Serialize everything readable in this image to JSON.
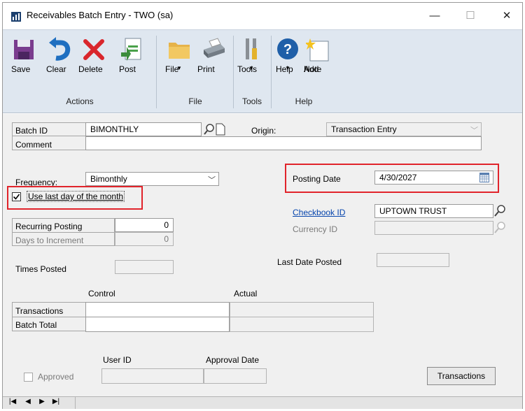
{
  "window": {
    "title": "Receivables Batch Entry  -  TWO (sa)",
    "minimize": "—",
    "maximize": "☐",
    "close": "✕"
  },
  "ribbon": {
    "buttons": {
      "save": "Save",
      "clear": "Clear",
      "delete": "Delete",
      "post": "Post",
      "file": "File",
      "print": "Print",
      "tools": "Tools",
      "help": "Help",
      "add_note_1": "Add",
      "add_note_2": "Note"
    },
    "groups": {
      "actions": "Actions",
      "file": "File",
      "tools": "Tools",
      "help": "Help"
    },
    "accent": "#1f5fa8"
  },
  "form": {
    "batch_id_label": "Batch ID",
    "batch_id_value": "BIMONTHLY",
    "origin_label": "Origin:",
    "origin_value": "Transaction Entry",
    "comment_label": "Comment",
    "comment_value": "",
    "frequency_label": "Frequency:",
    "frequency_value": "Bimonthly",
    "use_last_day_label": "Use last day of the month",
    "use_last_day_checked": true,
    "posting_date_label": "Posting Date",
    "posting_date_value": "4/30/2027",
    "checkbook_id_label": "Checkbook ID",
    "checkbook_id_value": "UPTOWN TRUST",
    "currency_id_label": "Currency ID",
    "currency_id_value": "",
    "recurring_posting_label": "Recurring Posting",
    "recurring_posting_value": "0",
    "days_to_increment_label": "Days to Increment",
    "days_to_increment_value": "0",
    "times_posted_label": "Times Posted",
    "times_posted_value": "",
    "last_date_posted_label": "Last Date Posted",
    "last_date_posted_value": "",
    "control_header": "Control",
    "actual_header": "Actual",
    "transactions_label": "Transactions",
    "batch_total_label": "Batch Total",
    "user_id_header": "User ID",
    "approval_date_header": "Approval Date",
    "approved_label": "Approved",
    "transactions_button": "Transactions",
    "highlight_color": "#e1242b"
  },
  "nav": {
    "first": "|◀",
    "prev": "◀",
    "next": "▶",
    "last": "▶|"
  }
}
